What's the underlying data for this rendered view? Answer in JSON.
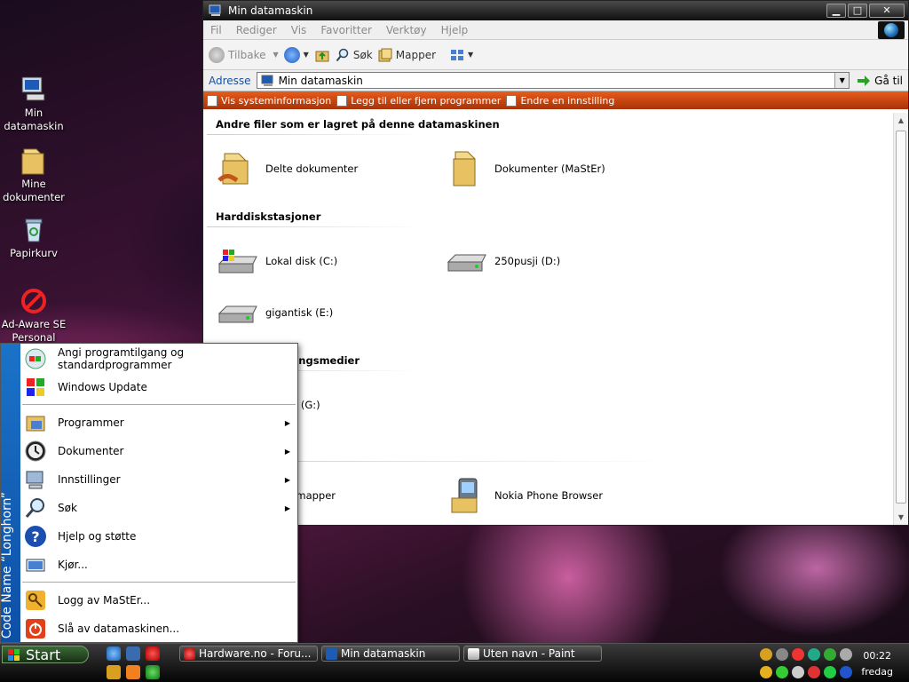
{
  "desktop": {
    "icons": [
      {
        "label": "Min datamaskin"
      },
      {
        "label": "Mine dokumenter"
      },
      {
        "label": "Papirkurv"
      },
      {
        "label": "Ad-Aware SE Personal"
      }
    ]
  },
  "window": {
    "title": "Min datamaskin",
    "menu": [
      "Fil",
      "Rediger",
      "Vis",
      "Favoritter",
      "Verktøy",
      "Hjelp"
    ],
    "toolbar": {
      "back": "Tilbake",
      "search": "Søk",
      "folders": "Mapper"
    },
    "address": {
      "label": "Adresse",
      "value": "Min datamaskin",
      "go": "Gå til"
    },
    "tasks": [
      "Vis systeminformasjon",
      "Legg til eller fjern programmer",
      "Endre en innstilling"
    ],
    "groups": {
      "other_files": "Andre filer som er lagret på denne datamaskinen",
      "harddisks": "Harddiskstasjoner",
      "removable": "Flyttbare lagringsmedier"
    },
    "items": {
      "shared_docs": "Delte dokumenter",
      "master_docs": "Dokumenter (MaStEr)",
      "disk_c": "Lokal disk (C:)",
      "disk_d": "250pusji (D:)",
      "disk_e": "gigantisk (E:)",
      "removable_g": "ICNG2 (G:)",
      "shared_folders": "Delte mapper",
      "nokia": "Nokia Phone Browser"
    }
  },
  "startmenu": {
    "sidebar_text": "Code Name “Longhorn”",
    "top": [
      "Angi programtilgang og standardprogrammer",
      "Windows Update"
    ],
    "main": [
      "Programmer",
      "Dokumenter",
      "Innstillinger",
      "Søk",
      "Hjelp og støtte",
      "Kjør..."
    ],
    "bottom": [
      "Logg av MaStEr...",
      "Slå av datamaskinen..."
    ]
  },
  "taskbar": {
    "start": "Start",
    "tasks": [
      "Hardware.no - Foru...",
      "Min datamaskin",
      "Uten navn - Paint"
    ],
    "clock": {
      "time": "00:22",
      "day": "fredag"
    }
  },
  "colors": {
    "tasks_bar": "#c8460e",
    "start_sidebar": "#1a73c8",
    "start_button": "#2c5628"
  }
}
